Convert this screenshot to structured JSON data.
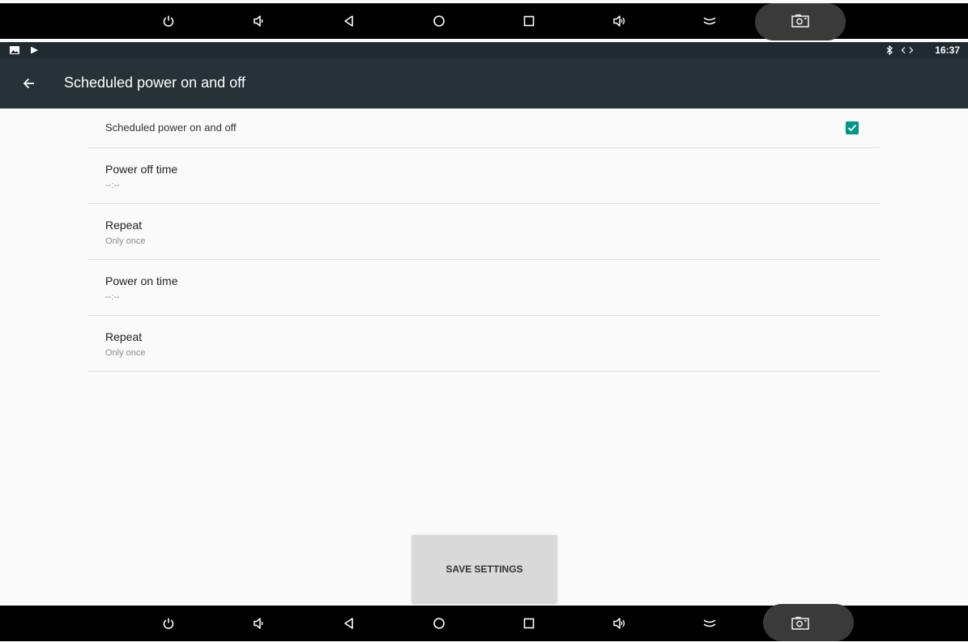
{
  "status_bar": {
    "time": "16:37",
    "icons": [
      "image-icon",
      "play-icon",
      "bluetooth-icon",
      "data-transfer-icon"
    ]
  },
  "nav_bar": {
    "buttons": [
      "power-icon",
      "volume-down-icon",
      "back-icon",
      "home-icon",
      "recents-icon",
      "volume-up-icon",
      "hide-icon",
      "screenshot-icon"
    ]
  },
  "toolbar": {
    "title": "Scheduled power on and off",
    "back_icon": "arrow-left-icon"
  },
  "settings": {
    "enable": {
      "title": "Scheduled power on and off",
      "checked": true
    },
    "power_off": {
      "title": "Power off time",
      "value": "--:--"
    },
    "repeat_off": {
      "title": "Repeat",
      "value": "Only once"
    },
    "power_on": {
      "title": "Power on time",
      "value": "--:--"
    },
    "repeat_on": {
      "title": "Repeat",
      "value": "Only once"
    }
  },
  "save_button": {
    "label": "SAVE SETTINGS"
  },
  "colors": {
    "toolbar": "#263238",
    "accent": "#009688",
    "background": "#fafafa"
  }
}
